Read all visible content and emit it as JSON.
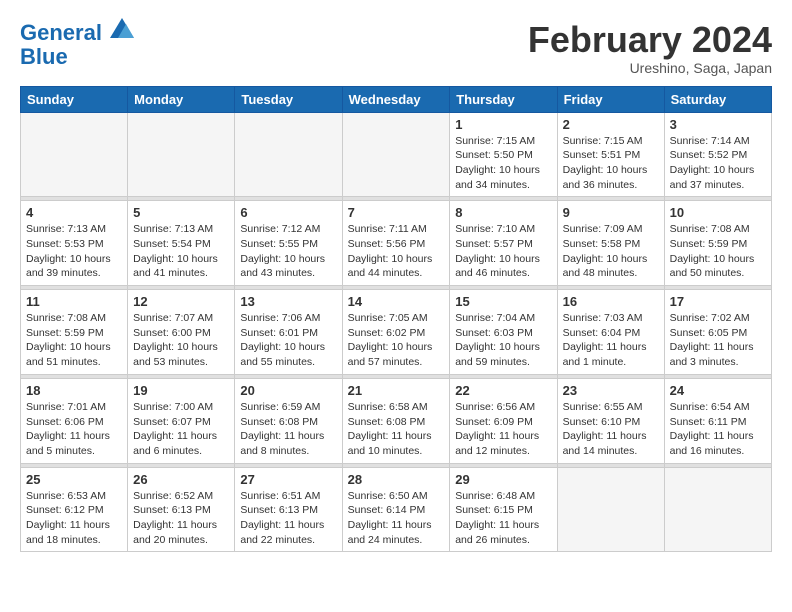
{
  "logo": {
    "line1": "General",
    "line2": "Blue"
  },
  "title": "February 2024",
  "subtitle": "Ureshino, Saga, Japan",
  "weekdays": [
    "Sunday",
    "Monday",
    "Tuesday",
    "Wednesday",
    "Thursday",
    "Friday",
    "Saturday"
  ],
  "weeks": [
    [
      {
        "day": "",
        "info": ""
      },
      {
        "day": "",
        "info": ""
      },
      {
        "day": "",
        "info": ""
      },
      {
        "day": "",
        "info": ""
      },
      {
        "day": "1",
        "info": "Sunrise: 7:15 AM\nSunset: 5:50 PM\nDaylight: 10 hours\nand 34 minutes."
      },
      {
        "day": "2",
        "info": "Sunrise: 7:15 AM\nSunset: 5:51 PM\nDaylight: 10 hours\nand 36 minutes."
      },
      {
        "day": "3",
        "info": "Sunrise: 7:14 AM\nSunset: 5:52 PM\nDaylight: 10 hours\nand 37 minutes."
      }
    ],
    [
      {
        "day": "4",
        "info": "Sunrise: 7:13 AM\nSunset: 5:53 PM\nDaylight: 10 hours\nand 39 minutes."
      },
      {
        "day": "5",
        "info": "Sunrise: 7:13 AM\nSunset: 5:54 PM\nDaylight: 10 hours\nand 41 minutes."
      },
      {
        "day": "6",
        "info": "Sunrise: 7:12 AM\nSunset: 5:55 PM\nDaylight: 10 hours\nand 43 minutes."
      },
      {
        "day": "7",
        "info": "Sunrise: 7:11 AM\nSunset: 5:56 PM\nDaylight: 10 hours\nand 44 minutes."
      },
      {
        "day": "8",
        "info": "Sunrise: 7:10 AM\nSunset: 5:57 PM\nDaylight: 10 hours\nand 46 minutes."
      },
      {
        "day": "9",
        "info": "Sunrise: 7:09 AM\nSunset: 5:58 PM\nDaylight: 10 hours\nand 48 minutes."
      },
      {
        "day": "10",
        "info": "Sunrise: 7:08 AM\nSunset: 5:59 PM\nDaylight: 10 hours\nand 50 minutes."
      }
    ],
    [
      {
        "day": "11",
        "info": "Sunrise: 7:08 AM\nSunset: 5:59 PM\nDaylight: 10 hours\nand 51 minutes."
      },
      {
        "day": "12",
        "info": "Sunrise: 7:07 AM\nSunset: 6:00 PM\nDaylight: 10 hours\nand 53 minutes."
      },
      {
        "day": "13",
        "info": "Sunrise: 7:06 AM\nSunset: 6:01 PM\nDaylight: 10 hours\nand 55 minutes."
      },
      {
        "day": "14",
        "info": "Sunrise: 7:05 AM\nSunset: 6:02 PM\nDaylight: 10 hours\nand 57 minutes."
      },
      {
        "day": "15",
        "info": "Sunrise: 7:04 AM\nSunset: 6:03 PM\nDaylight: 10 hours\nand 59 minutes."
      },
      {
        "day": "16",
        "info": "Sunrise: 7:03 AM\nSunset: 6:04 PM\nDaylight: 11 hours\nand 1 minute."
      },
      {
        "day": "17",
        "info": "Sunrise: 7:02 AM\nSunset: 6:05 PM\nDaylight: 11 hours\nand 3 minutes."
      }
    ],
    [
      {
        "day": "18",
        "info": "Sunrise: 7:01 AM\nSunset: 6:06 PM\nDaylight: 11 hours\nand 5 minutes."
      },
      {
        "day": "19",
        "info": "Sunrise: 7:00 AM\nSunset: 6:07 PM\nDaylight: 11 hours\nand 6 minutes."
      },
      {
        "day": "20",
        "info": "Sunrise: 6:59 AM\nSunset: 6:08 PM\nDaylight: 11 hours\nand 8 minutes."
      },
      {
        "day": "21",
        "info": "Sunrise: 6:58 AM\nSunset: 6:08 PM\nDaylight: 11 hours\nand 10 minutes."
      },
      {
        "day": "22",
        "info": "Sunrise: 6:56 AM\nSunset: 6:09 PM\nDaylight: 11 hours\nand 12 minutes."
      },
      {
        "day": "23",
        "info": "Sunrise: 6:55 AM\nSunset: 6:10 PM\nDaylight: 11 hours\nand 14 minutes."
      },
      {
        "day": "24",
        "info": "Sunrise: 6:54 AM\nSunset: 6:11 PM\nDaylight: 11 hours\nand 16 minutes."
      }
    ],
    [
      {
        "day": "25",
        "info": "Sunrise: 6:53 AM\nSunset: 6:12 PM\nDaylight: 11 hours\nand 18 minutes."
      },
      {
        "day": "26",
        "info": "Sunrise: 6:52 AM\nSunset: 6:13 PM\nDaylight: 11 hours\nand 20 minutes."
      },
      {
        "day": "27",
        "info": "Sunrise: 6:51 AM\nSunset: 6:13 PM\nDaylight: 11 hours\nand 22 minutes."
      },
      {
        "day": "28",
        "info": "Sunrise: 6:50 AM\nSunset: 6:14 PM\nDaylight: 11 hours\nand 24 minutes."
      },
      {
        "day": "29",
        "info": "Sunrise: 6:48 AM\nSunset: 6:15 PM\nDaylight: 11 hours\nand 26 minutes."
      },
      {
        "day": "",
        "info": ""
      },
      {
        "day": "",
        "info": ""
      }
    ]
  ]
}
